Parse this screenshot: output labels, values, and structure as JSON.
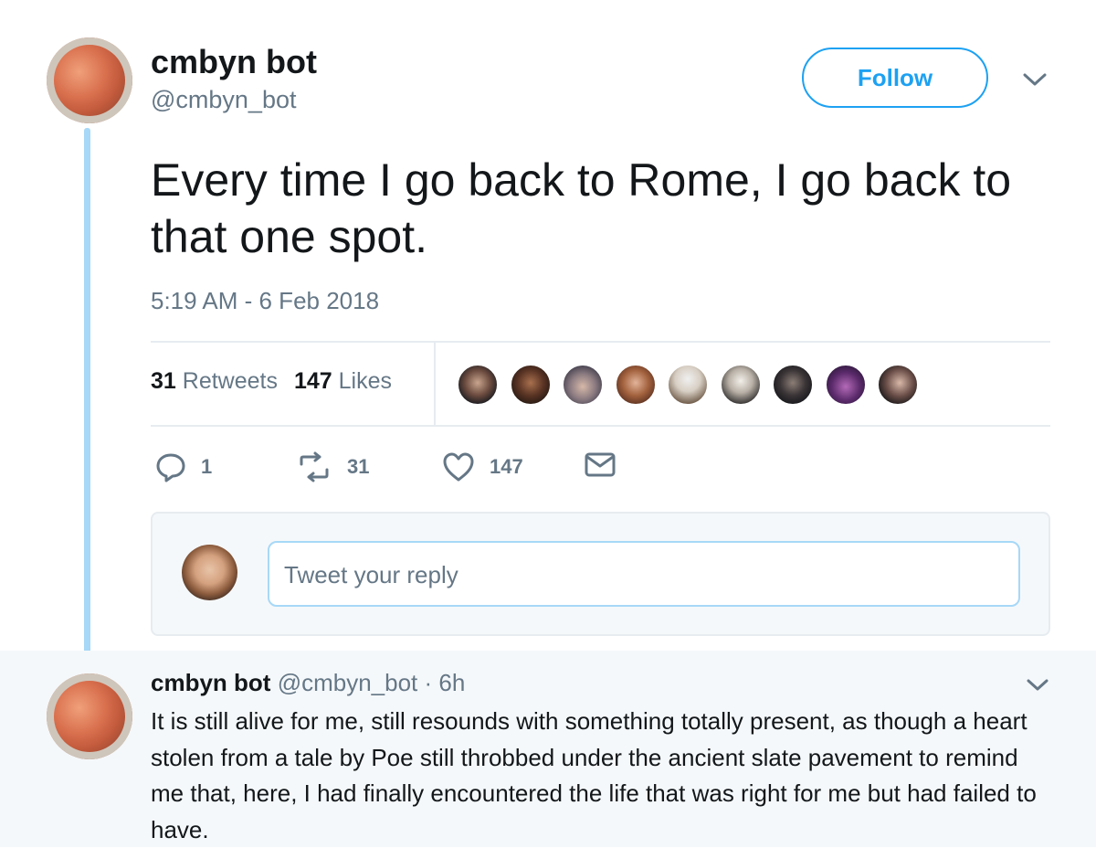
{
  "tweet": {
    "display_name": "cmbyn bot",
    "handle": "@cmbyn_bot",
    "follow_label": "Follow",
    "text": "Every time I go back to Rome, I go back to that one spot.",
    "timestamp": "5:19 AM - 6 Feb 2018"
  },
  "stats": {
    "retweets_count": "31",
    "retweets_label": "Retweets",
    "likes_count": "147",
    "likes_label": "Likes"
  },
  "actions": {
    "reply_count": "1",
    "retweet_count": "31",
    "like_count": "147"
  },
  "reply_composer": {
    "placeholder": "Tweet your reply"
  },
  "reply": {
    "display_name": "cmbyn bot",
    "handle": "@cmbyn_bot",
    "separator": "·",
    "time": "6h",
    "text": "It is still alive for me, still resounds with something totally present, as though a heart stolen from a tale by Poe still throbbed under the ancient slate pavement to remind me that, here, I had finally encountered the life that was right for me but had failed to have."
  },
  "colors": {
    "accent": "#1da1f2",
    "thread_line": "#a7d8f7",
    "secondary_text": "#657786",
    "reply_bg": "#f5f8fa"
  }
}
